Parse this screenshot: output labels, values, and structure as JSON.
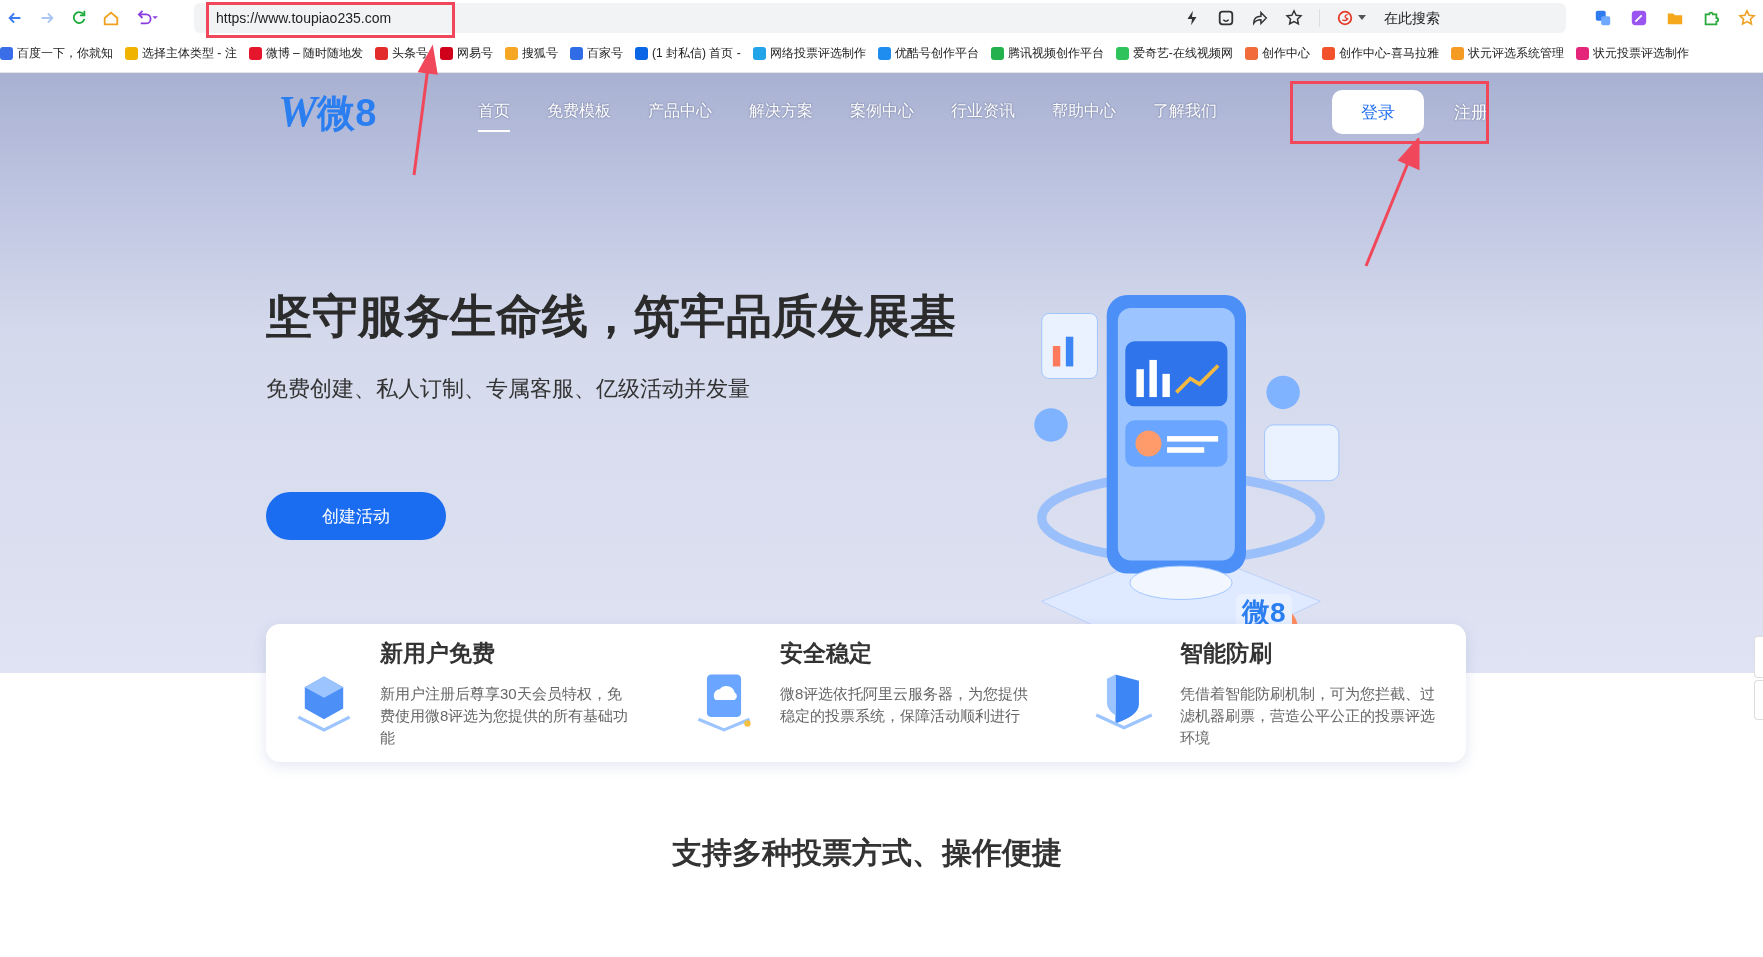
{
  "browser": {
    "url": "https://www.toupiao235.com",
    "search_placeholder": "在此搜索"
  },
  "bookmarks": [
    {
      "label": "百度一下，你就知",
      "color": "#3a6ee8"
    },
    {
      "label": "选择主体类型 - 注",
      "color": "#f0b400"
    },
    {
      "label": "微博 – 随时随地发",
      "color": "#e6162d"
    },
    {
      "label": "头条号",
      "color": "#e22c2c"
    },
    {
      "label": "网易号",
      "color": "#d0021b"
    },
    {
      "label": "搜狐号",
      "color": "#f5a623"
    },
    {
      "label": "百家号",
      "color": "#2f6ce5"
    },
    {
      "label": "(1 封私信) 首页 -",
      "color": "#0a66e4"
    },
    {
      "label": "网络投票评选制作",
      "color": "#23a3e8"
    },
    {
      "label": "优酷号创作平台",
      "color": "#1f8cf0"
    },
    {
      "label": "腾讯视频创作平台",
      "color": "#22b14c"
    },
    {
      "label": "爱奇艺-在线视频网",
      "color": "#2ec45b"
    },
    {
      "label": "创作中心",
      "color": "#f26b3a"
    },
    {
      "label": "创作中心-喜马拉雅",
      "color": "#f2512c"
    },
    {
      "label": "状元评选系统管理",
      "color": "#f59a23"
    },
    {
      "label": "状元投票评选制作",
      "color": "#e4257a"
    }
  ],
  "site": {
    "logo_mark": "W",
    "logo_text": "微8",
    "nav": [
      {
        "label": "首页",
        "selected": true
      },
      {
        "label": "免费模板",
        "selected": false
      },
      {
        "label": "产品中心",
        "selected": false
      },
      {
        "label": "解决方案",
        "selected": false
      },
      {
        "label": "案例中心",
        "selected": false
      },
      {
        "label": "行业资讯",
        "selected": false
      },
      {
        "label": "帮助中心",
        "selected": false
      },
      {
        "label": "了解我们",
        "selected": false
      }
    ],
    "login": "登录",
    "register": "注册"
  },
  "hero": {
    "title": "坚守服务生命线，筑牢品质发展基",
    "subtitle": "免费创建、私人订制、专属客服、亿级活动并发量",
    "cta": "创建活动",
    "badge": "微8"
  },
  "features": [
    {
      "kind": "cube",
      "title": "新用户免费",
      "text": "新用户注册后尊享30天会员特权，免费使用微8评选为您提供的所有基础功能"
    },
    {
      "kind": "cloud",
      "title": "安全稳定",
      "text": "微8评选依托阿里云服务器，为您提供稳定的投票系统，保障活动顺利进行"
    },
    {
      "kind": "shield",
      "title": "智能防刷",
      "text": "凭借着智能防刷机制，可为您拦截、过滤机器刷票，营造公平公正的投票评选环境"
    }
  ],
  "section_title": "支持多种投票方式、操作便捷"
}
